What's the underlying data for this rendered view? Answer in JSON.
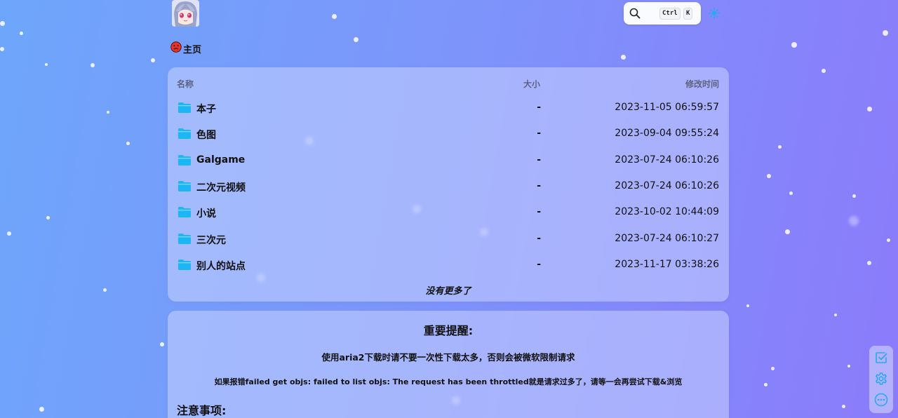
{
  "header": {
    "search": {
      "shortcut_ctrl": "Ctrl",
      "shortcut_key": "K"
    }
  },
  "breadcrumb": {
    "home_label": "主页"
  },
  "file_list": {
    "columns": {
      "name": "名称",
      "size": "大小",
      "modified": "修改时间"
    },
    "rows": [
      {
        "name": "本子",
        "size": "-",
        "modified": "2023-11-05 06:59:57"
      },
      {
        "name": "色图",
        "size": "-",
        "modified": "2023-09-04 09:55:24"
      },
      {
        "name": "Galgame",
        "size": "-",
        "modified": "2023-07-24 06:10:26"
      },
      {
        "name": "二次元视频",
        "size": "-",
        "modified": "2023-07-24 06:10:26"
      },
      {
        "name": "小说",
        "size": "-",
        "modified": "2023-10-02 10:44:09"
      },
      {
        "name": "三次元",
        "size": "-",
        "modified": "2023-07-24 06:10:27"
      },
      {
        "name": "别人的站点",
        "size": "-",
        "modified": "2023-11-17 03:38:26"
      }
    ],
    "end_text": "没有更多了"
  },
  "notice": {
    "title": "重要提醒:",
    "line1": "使用aria2下载时请不要一次性下载太多，否则会被微软限制请求",
    "line2": "如果报错failed get objs: failed to list objs: The request has been throttled就是请求过多了，请等一会再尝试下载&浏览",
    "notes_title": "注意事项:"
  },
  "colors": {
    "folder": "#1cb6f5",
    "accent": "#2aa9ef",
    "home_icon": "#e8332b"
  },
  "icons": {
    "search": "search-icon",
    "theme": "theme-toggle-icon",
    "home": "home-icon",
    "folder": "folder-icon",
    "select": "checkbox-select-icon",
    "settings": "gear-icon",
    "more": "more-icon"
  }
}
